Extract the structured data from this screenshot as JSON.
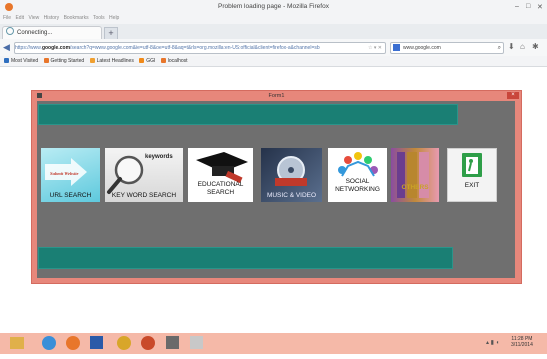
{
  "browser": {
    "window_title": "Problem loading page - Mozilla Firefox",
    "window_controls": [
      "–",
      "□",
      "✕"
    ],
    "menu": [
      "File",
      "Edit",
      "View",
      "History",
      "Bookmarks",
      "Tools",
      "Help"
    ],
    "tab_label": "Connecting...",
    "new_tab": "+",
    "url_prefix": "https://www.",
    "url_host": "google.com",
    "url_rest": "/search?q=www.google.com&ie=utf-8&oe=utf-8&aq=t&rls=org.mozilla:en-US:official&client=firefox-a&channel=sb",
    "url_tail": "☆ ▾ ✕",
    "search_value": "www.google.com",
    "bookmarks": [
      {
        "label": "Most Visited",
        "color": "#2f6fbf"
      },
      {
        "label": "Getting Started",
        "color": "#e8762b"
      },
      {
        "label": "Latest Headlines",
        "color": "#f0a030"
      },
      {
        "label": "GGI",
        "color": "#f08a1a"
      },
      {
        "label": "localhost",
        "color": "#e8762b"
      }
    ]
  },
  "form": {
    "title": "Form1",
    "close": "×",
    "tiles": [
      {
        "name": "url-search-tile",
        "label": "URL SEARCH",
        "overlay_text": "Submit Website",
        "icon": "url-search-icon"
      },
      {
        "name": "keyword-search-tile",
        "label": "KEY WORD SEARCH",
        "overlay_text": "keywords",
        "icon": "magnifier-icon"
      },
      {
        "name": "educational-search-tile",
        "label": "EDUCATIONAL SEARCH",
        "icon": "graduation-cap-icon"
      },
      {
        "name": "music-video-tile",
        "label": "MUSIC & VIDEO",
        "icon": "film-reel-icon"
      },
      {
        "name": "social-networking-tile",
        "label": "SOCIAL NETWORKING",
        "icon": "people-network-icon"
      },
      {
        "name": "others-tile",
        "label": "OTHERS",
        "icon": "books-icon"
      },
      {
        "name": "exit-tile",
        "label": "EXIT",
        "icon": "exit-door-icon"
      }
    ]
  },
  "taskbar": {
    "time": "11:28 PM",
    "date": "3/11/2014"
  },
  "colors": {
    "form_border": "#e7877b",
    "client_bg": "#6f6f6f",
    "band": "#1a7f74",
    "taskbar": "#f5b9a8"
  }
}
